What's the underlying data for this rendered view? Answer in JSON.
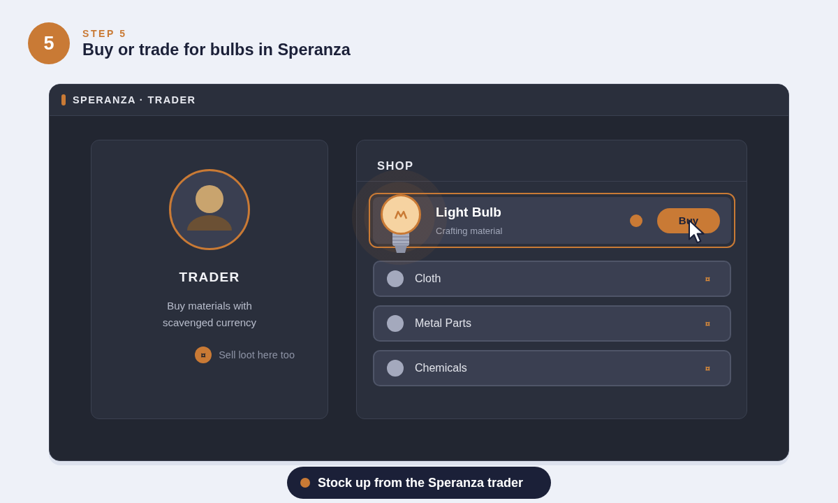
{
  "step": {
    "badge": "5",
    "label": "STEP 5",
    "title": "Buy or trade for bulbs in Speranza"
  },
  "window": {
    "title": "SPERANZA · TRADER"
  },
  "trader_card": {
    "name": "TRADER",
    "description": "Buy materials with scavenged currency",
    "note_symbol": "¤",
    "note": "Sell loot here too"
  },
  "shop": {
    "title": "SHOP",
    "items": [
      {
        "kind": "featured",
        "name": "Light Bulb",
        "subtitle": "Crafting material",
        "button": "Buy",
        "selected": true
      },
      {
        "kind": "plain",
        "name": "Cloth",
        "currency": "¤",
        "selected": false
      },
      {
        "kind": "plain",
        "name": "Metal Parts",
        "currency": "¤",
        "selected": false
      },
      {
        "kind": "plain",
        "name": "Chemicals",
        "currency": "¤",
        "selected": false
      }
    ]
  },
  "caption": "Stock up from the Speranza trader"
}
